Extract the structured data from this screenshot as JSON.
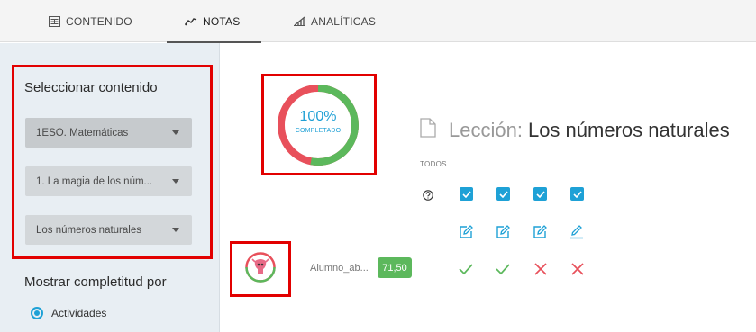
{
  "tabs": [
    {
      "label": "CONTENIDO",
      "icon": "content-icon"
    },
    {
      "label": "NOTAS",
      "icon": "grades-chart-icon",
      "active": true
    },
    {
      "label": "ANALÍTICAS",
      "icon": "analytics-icon"
    }
  ],
  "sidebar": {
    "title": "Seleccionar contenido",
    "dropdowns": [
      {
        "value": "1ESO. Matemáticas"
      },
      {
        "value": "1. La magia de los núm..."
      },
      {
        "value": "Los números naturales"
      }
    ],
    "completeness_title": "Mostrar completitud por",
    "radio_option": "Actividades"
  },
  "progress": {
    "percent_text": "100%",
    "label": "COMPLETADO",
    "completed_fraction": 0.53,
    "colors": {
      "completed": "#5cb85c",
      "pending": "#e8505b"
    }
  },
  "lesson": {
    "prefix": "Lección:",
    "name": "Los números naturales"
  },
  "todos_label": "TODOS",
  "student": {
    "name": "Alumno_ab...",
    "score": "71,50",
    "results": [
      "correct",
      "correct",
      "wrong",
      "wrong"
    ]
  },
  "colors": {
    "accent": "#1ea1d6",
    "highlight_border": "#e20000",
    "correct": "#5cb85c",
    "wrong": "#e8505b"
  }
}
